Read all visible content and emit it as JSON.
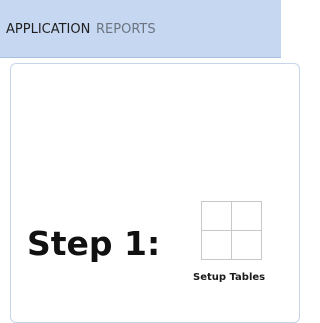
{
  "nav": {
    "tabs": [
      {
        "label": "APPLICATION"
      },
      {
        "label": "REPORTS"
      }
    ]
  },
  "main": {
    "step_heading": "Step 1:",
    "tiles": [
      {
        "label": "Setup Tables",
        "icon": "grid-icon"
      }
    ]
  },
  "colors": {
    "top_bar": "#c5d7f1",
    "active_tab_text": "#1f1f1f",
    "inactive_tab_text": "#6d7480",
    "panel_border": "#c6d5ea"
  }
}
